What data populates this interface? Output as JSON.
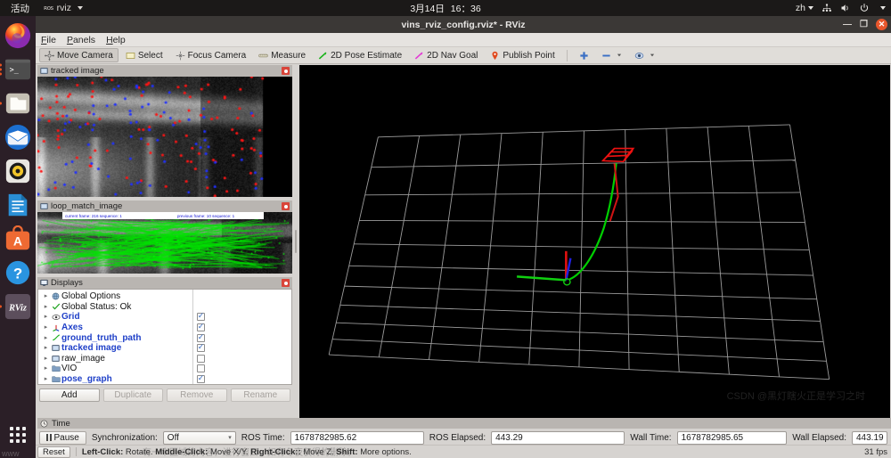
{
  "topbar": {
    "activities": "活动",
    "app_name": "rviz",
    "ros_mark": "ROS",
    "date": "3月14日",
    "time": "16：36",
    "language": "zh",
    "tray_icons": [
      "network-icon",
      "volume-icon",
      "power-icon",
      "chevron-down-icon"
    ]
  },
  "dock": {
    "items": [
      {
        "name": "firefox",
        "label": "Firefox",
        "running": false
      },
      {
        "name": "terminal",
        "label": "Terminal",
        "running": true
      },
      {
        "name": "files",
        "label": "Files",
        "running": true
      },
      {
        "name": "thunderbird",
        "label": "Thunderbird",
        "running": false
      },
      {
        "name": "rhythmbox",
        "label": "Rhythmbox",
        "running": false
      },
      {
        "name": "libreoffice-writer",
        "label": "LibreOffice Writer",
        "running": false
      },
      {
        "name": "ubuntu-software",
        "label": "Ubuntu Software",
        "running": false
      },
      {
        "name": "help",
        "label": "Help",
        "running": false
      },
      {
        "name": "rviz",
        "label": "RViz",
        "running": true
      }
    ],
    "show_apps_label": "Show Applications"
  },
  "window": {
    "title": "vins_rviz_config.rviz* - RViz",
    "minimize": "—",
    "maximize": "❐",
    "close": "✕"
  },
  "menubar": {
    "items": [
      "File",
      "Panels",
      "Help"
    ]
  },
  "toolbar": {
    "items": [
      {
        "label": "Move Camera",
        "icon": "move-camera-icon",
        "active": true
      },
      {
        "label": "Select",
        "icon": "select-icon",
        "active": false
      },
      {
        "label": "Focus Camera",
        "icon": "focus-camera-icon",
        "active": false
      },
      {
        "label": "Measure",
        "icon": "measure-icon",
        "active": false
      },
      {
        "label": "2D Pose Estimate",
        "icon": "pose-estimate-icon",
        "active": false
      },
      {
        "label": "2D Nav Goal",
        "icon": "nav-goal-icon",
        "active": false
      },
      {
        "label": "Publish Point",
        "icon": "publish-point-icon",
        "active": false
      }
    ],
    "extra_icons": [
      "add-tool-icon",
      "remove-tool-icon",
      "tool-properties-icon"
    ]
  },
  "panels": {
    "tracked_image": {
      "title": "tracked image"
    },
    "loop_match_image": {
      "title": "loop_match_image",
      "overlay_left": "current frame: 216   sequence: 1",
      "overlay_right": "previous frame: 10   sequence: 1"
    },
    "displays": {
      "title": "Displays",
      "tree": [
        {
          "label": "Global Options",
          "icon": "globe-icon",
          "highlight": false,
          "checkbox": null
        },
        {
          "label": "Global Status: Ok",
          "icon": "check-icon",
          "highlight": false,
          "checkbox": null
        },
        {
          "label": "Grid",
          "icon": "grid-icon",
          "highlight": true,
          "checkbox": true
        },
        {
          "label": "Axes",
          "icon": "axes-icon",
          "highlight": true,
          "checkbox": true
        },
        {
          "label": "ground_truth_path",
          "icon": "path-icon",
          "highlight": true,
          "checkbox": true
        },
        {
          "label": "tracked image",
          "icon": "image-icon",
          "highlight": true,
          "checkbox": true
        },
        {
          "label": "raw_image",
          "icon": "image-icon",
          "highlight": false,
          "checkbox": false
        },
        {
          "label": "VIO",
          "icon": "group-icon",
          "highlight": false,
          "checkbox": false
        },
        {
          "label": "pose_graph",
          "icon": "group-icon",
          "highlight": true,
          "checkbox": true
        }
      ],
      "buttons": [
        {
          "label": "Add",
          "enabled": true
        },
        {
          "label": "Duplicate",
          "enabled": false
        },
        {
          "label": "Remove",
          "enabled": false
        },
        {
          "label": "Rename",
          "enabled": false
        }
      ]
    },
    "time": {
      "title": "Time",
      "pause_label": "Pause",
      "sync_label": "Synchronization:",
      "sync_value": "Off",
      "ros_time_label": "ROS Time:",
      "ros_time_value": "1678782985.62",
      "ros_elapsed_label": "ROS Elapsed:",
      "ros_elapsed_value": "443.29",
      "wall_time_label": "Wall Time:",
      "wall_time_value": "1678782985.65",
      "wall_elapsed_label": "Wall Elapsed:",
      "wall_elapsed_value": "443.19"
    }
  },
  "statusbar": {
    "reset_label": "Reset",
    "hints": [
      {
        "key": "Left-Click:",
        "action": " Rotate."
      },
      {
        "key": "Middle-Click:",
        "action": " Move X/Y."
      },
      {
        "key": "Right-Click::",
        "action": " Move Z."
      },
      {
        "key": "Shift:",
        "action": " More options."
      }
    ],
    "fps": "31 fps"
  },
  "watermarks": {
    "main": "CSDN @黑灯瞎火正是学习之时",
    "status": "有一个区域的内容，进行窗口，如有冬夜仅得的删除。",
    "dock": "www"
  },
  "view3d": {
    "background_color": "#000000",
    "grid_color": "#9b9b9b",
    "trajectory_color": "#00d000",
    "camera_marker_color": "#ee1111",
    "axis_x_color": "#e01010",
    "axis_y_color": "#10d010",
    "axis_z_color": "#2020e0",
    "grid_cells": 10
  }
}
